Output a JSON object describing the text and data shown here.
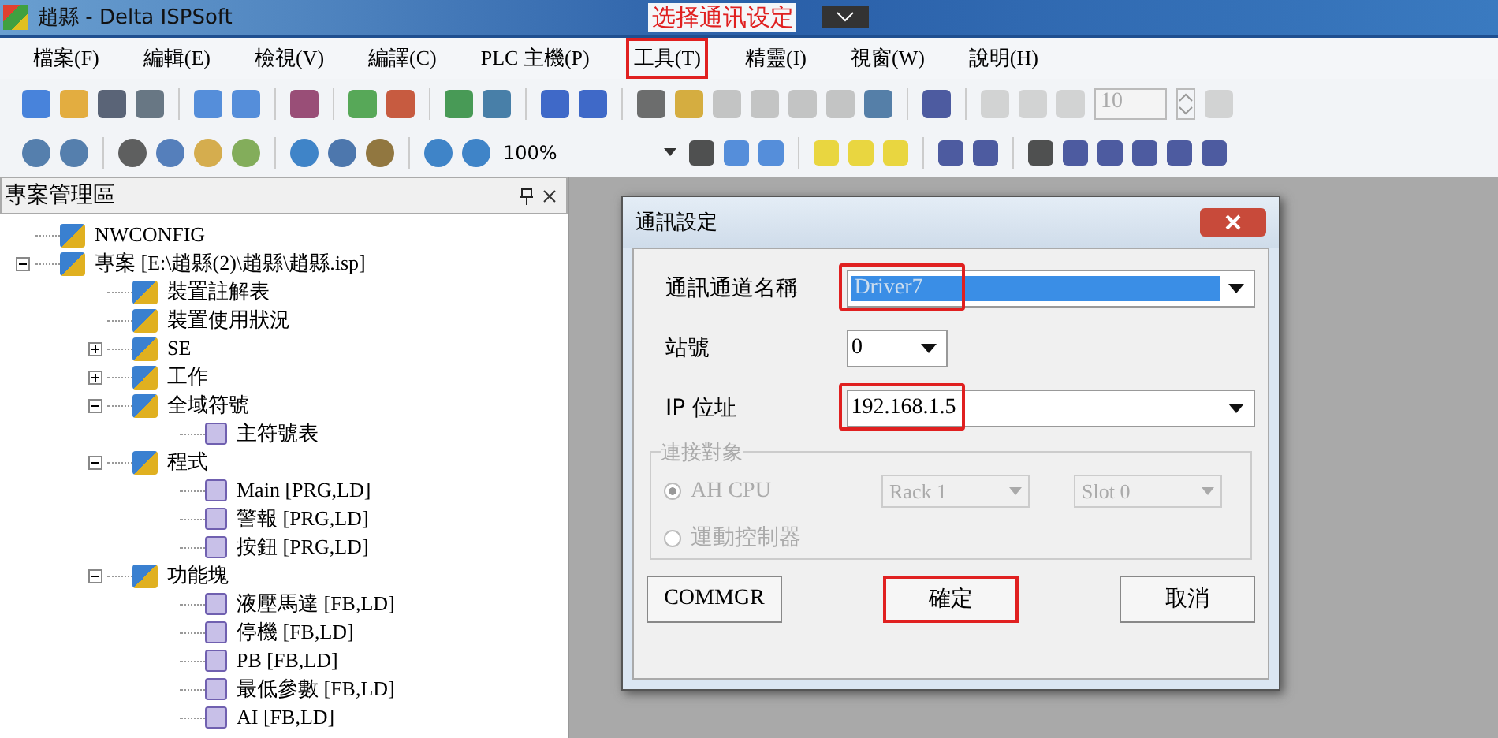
{
  "window": {
    "title": "趙縣 - Delta ISPSoft"
  },
  "annotation": {
    "text": "选择通讯设定"
  },
  "menu": [
    {
      "label": "檔案(F)",
      "highlighted": false
    },
    {
      "label": "編輯(E)",
      "highlighted": false
    },
    {
      "label": "檢視(V)",
      "highlighted": false
    },
    {
      "label": "編譯(C)",
      "highlighted": false
    },
    {
      "label": "PLC 主機(P)",
      "highlighted": false
    },
    {
      "label": "工具(T)",
      "highlighted": true
    },
    {
      "label": "精靈(I)",
      "highlighted": false
    },
    {
      "label": "視窗(W)",
      "highlighted": false
    },
    {
      "label": "說明(H)",
      "highlighted": false
    }
  ],
  "toolbar": {
    "spin_value": "10",
    "zoom": "100%"
  },
  "project_panel": {
    "title": "專案管理區",
    "tree": [
      {
        "label": "NWCONFIG"
      },
      {
        "label": "專案 [E:\\趙縣(2)\\趙縣\\趙縣.isp]",
        "expanded": true,
        "children": [
          {
            "label": "裝置註解表"
          },
          {
            "label": "裝置使用狀況"
          },
          {
            "label": "SE",
            "expanded": false
          },
          {
            "label": "工作",
            "expanded": false
          },
          {
            "label": "全域符號",
            "expanded": true,
            "children": [
              {
                "label": "主符號表"
              }
            ]
          },
          {
            "label": "程式",
            "expanded": true,
            "children": [
              {
                "label": "Main [PRG,LD]"
              },
              {
                "label": "警報 [PRG,LD]"
              },
              {
                "label": "按鈕 [PRG,LD]"
              }
            ]
          },
          {
            "label": "功能塊",
            "expanded": true,
            "children": [
              {
                "label": "液壓馬達 [FB,LD]"
              },
              {
                "label": "停機 [FB,LD]"
              },
              {
                "label": "PB [FB,LD]"
              },
              {
                "label": "最低參數 [FB,LD]"
              },
              {
                "label": "AI [FB,LD]"
              }
            ]
          }
        ]
      }
    ]
  },
  "dialog": {
    "title": "通訊設定",
    "fields": [
      {
        "label": "通訊通道名稱",
        "value": "Driver7",
        "kind": "wide",
        "selected": true,
        "highlighted": true
      },
      {
        "label": "站號",
        "value": "0",
        "kind": "short",
        "selected": false,
        "highlighted": false
      },
      {
        "label": "IP 位址",
        "value": "192.168.1.5",
        "kind": "wide",
        "selected": false,
        "highlighted": true
      }
    ],
    "group": {
      "title": "連接對象",
      "disabled": true,
      "options": [
        {
          "label": "AH CPU",
          "selected": true
        },
        {
          "label": "運動控制器",
          "selected": false
        }
      ],
      "combos": [
        "Rack 1",
        "Slot 0"
      ]
    },
    "buttons": [
      {
        "label": "COMMGR",
        "highlighted": false
      },
      {
        "label": "確定",
        "highlighted": true
      },
      {
        "label": "取消",
        "highlighted": false
      }
    ]
  }
}
